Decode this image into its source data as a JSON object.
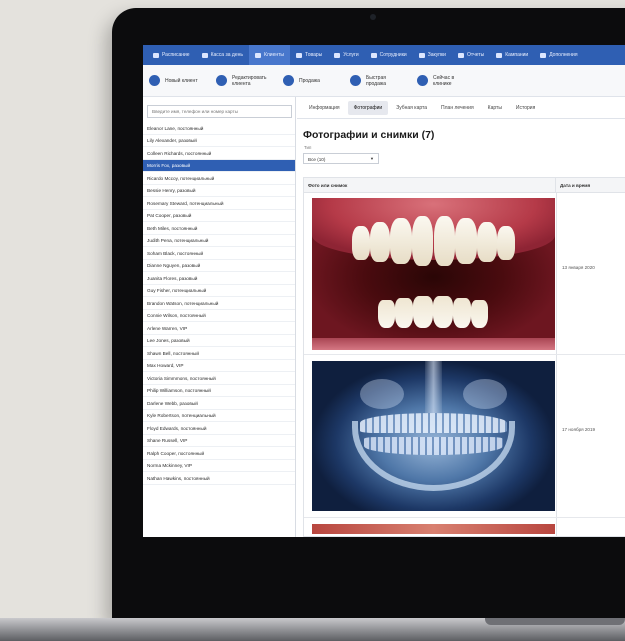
{
  "menu": [
    {
      "label": "Расписание",
      "active": false
    },
    {
      "label": "Касса за день",
      "active": false
    },
    {
      "label": "Клиенты",
      "active": true
    },
    {
      "label": "Товары",
      "active": false
    },
    {
      "label": "Услуги",
      "active": false
    },
    {
      "label": "Сотрудники",
      "active": false
    },
    {
      "label": "Закупки",
      "active": false
    },
    {
      "label": "Отчеты",
      "active": false
    },
    {
      "label": "Кампании",
      "active": false
    },
    {
      "label": "Дополнения",
      "active": false
    }
  ],
  "toolbar": [
    {
      "label": "Новый клиент",
      "icon": "add-client-icon",
      "color": "#2f5fb3"
    },
    {
      "label": "Редактировать клиента",
      "icon": "edit-icon",
      "color": "#2f5fb3"
    },
    {
      "label": "Продажа",
      "icon": "register-icon",
      "color": "#2f5fb3"
    },
    {
      "label": "Быстрая продажа",
      "icon": "quick-sale-icon",
      "color": "#2f5fb3"
    },
    {
      "label": "Сейчас в клинике",
      "icon": "in-clinic-icon",
      "color": "#2f5fb3"
    }
  ],
  "search": {
    "placeholder": "Введите имя, телефон или номер карты"
  },
  "clients": [
    "Eleanor Lane, постоянный",
    "Lily Alexander, разовый",
    "Colleen Richards, постоянный",
    "Morris Fox, разовый",
    "Ricardo Mccoy, потенциальный",
    "Bessie Henry, разовый",
    "Rosemary Steward, потенциальный",
    "Pat Cooper, разовый",
    "Beth Miles, постоянный",
    "Judith Pena, потенциальный",
    "Soham Black, постоянный",
    "Dianne Nguyen, разовый",
    "Juanita Flores, разовый",
    "Guy Fisher, потенциальный",
    "Brandon Watson, потенциальный",
    "Connie Wilson, постоянный",
    "Arlene Warren, VIP",
    "Lee Jones, разовый",
    "Shawn Bell, постоянный",
    "Max Howard, VIP",
    "Victoria Simmmons, постоянный",
    "Philip Williamson, постоянный",
    "Darlene Webb, разовый",
    "Kyle Robertson, потенциальный",
    "Floyd Edwards, постоянный",
    "Shane Russell, VIP",
    "Ralph Cooper, постоянный",
    "Norma Mckinney, VIP",
    "Nathan Hawkins, постоянный"
  ],
  "selected_client_index": 3,
  "tabs": [
    {
      "label": "Информация",
      "active": false
    },
    {
      "label": "Фотографии",
      "active": true
    },
    {
      "label": "Зубная карта",
      "active": false
    },
    {
      "label": "План лечения",
      "active": false
    },
    {
      "label": "Карты",
      "active": false
    },
    {
      "label": "История",
      "active": false
    }
  ],
  "page_title": "Фотографии и снимки (7)",
  "filter": {
    "label": "Тип",
    "value": "Все (10)"
  },
  "table": {
    "col_photo": "Фото или снимок",
    "col_date": "Дата и время",
    "rows": [
      {
        "date": "13 января 2020",
        "image": "intraoral-photo"
      },
      {
        "date": "17 ноября 2019",
        "image": "panoramic-xray"
      }
    ]
  },
  "colors": {
    "accent": "#2f5fb3",
    "selected_row": "#2f5fb3"
  }
}
